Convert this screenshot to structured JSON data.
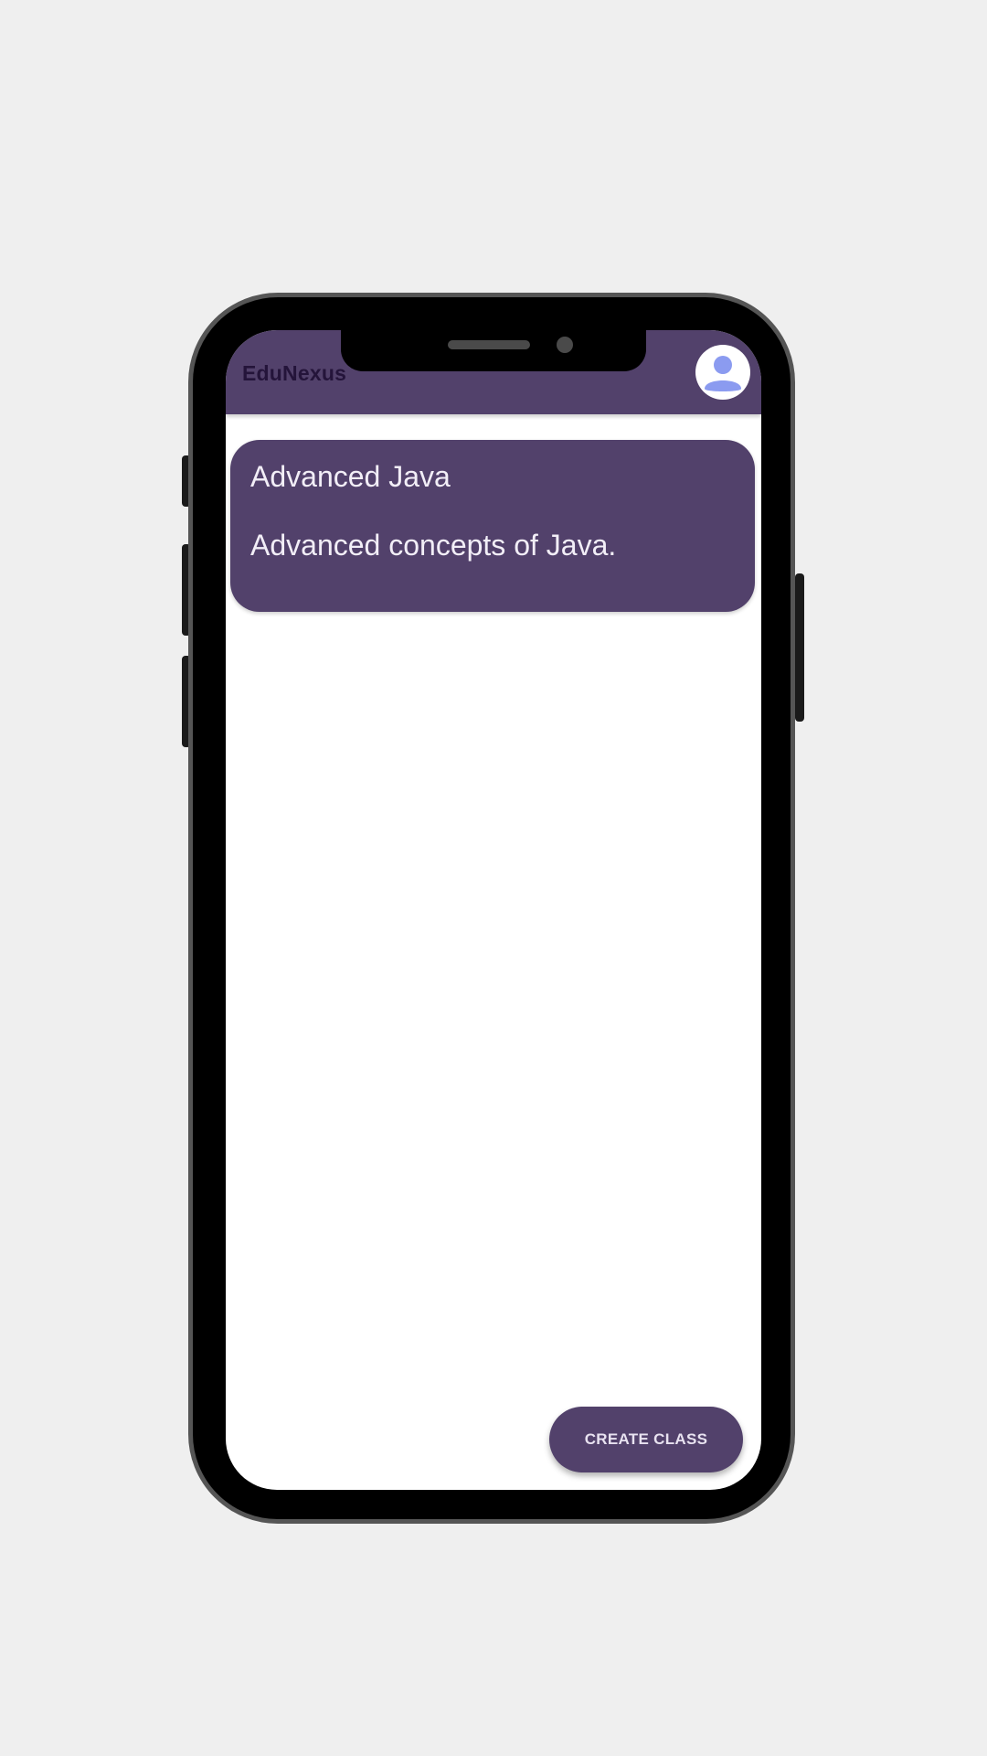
{
  "app": {
    "title": "EduNexus",
    "avatar_icon": "user-avatar-icon"
  },
  "classes": [
    {
      "name": "Advanced Java",
      "description": "Advanced concepts of Java."
    }
  ],
  "actions": {
    "create_class_label": "CREATE CLASS"
  },
  "colors": {
    "primary": "#52416b",
    "background": "#ffffff",
    "avatar_accent": "#8b9bf0"
  }
}
